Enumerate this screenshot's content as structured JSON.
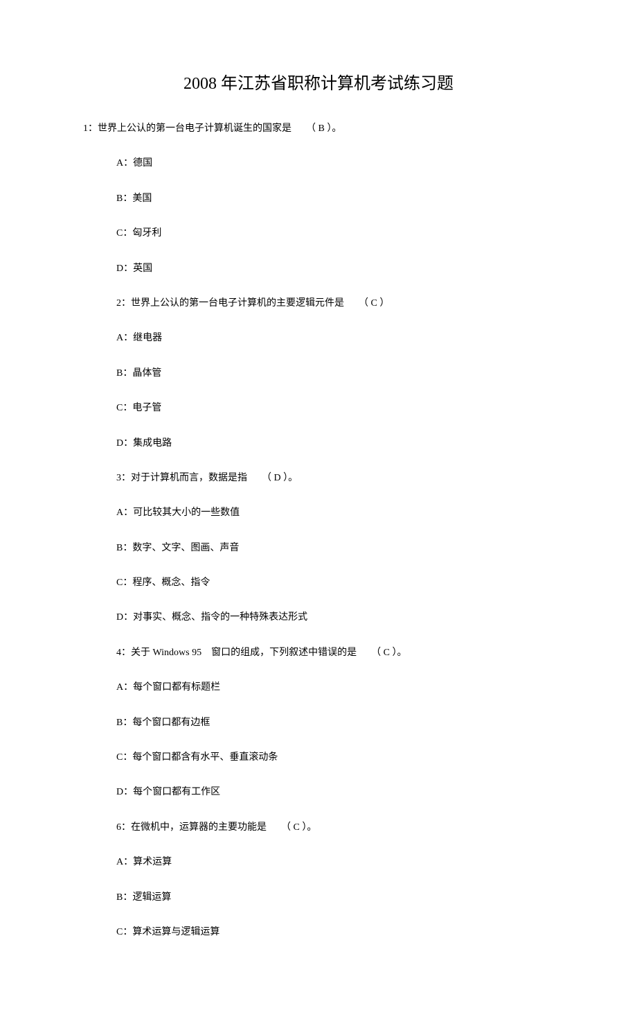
{
  "title": "2008 年江苏省职称计算机考试练习题",
  "q1": {
    "line": "1：世界上公认的第一台电子计算机诞生的国家是　　（ B ）。",
    "A": "A：德国",
    "B": "B：美国",
    "C": "C：匈牙利",
    "D": "D：英国"
  },
  "q2": {
    "line": "2：世界上公认的第一台电子计算机的主要逻辑元件是　　（ C ）",
    "A": "A：继电器",
    "B": "B：晶体管",
    "C": "C：电子管",
    "D": "D：集成电路"
  },
  "q3": {
    "line": "3：对于计算机而言，数据是指　　（ D ）。",
    "A": "A：可比较其大小的一些数值",
    "B": "B：数字、文字、图画、声音",
    "C": "C：程序、概念、指令",
    "D": "D：对事实、概念、指令的一种特殊表达形式"
  },
  "q4": {
    "line": "4：关于  Windows 95　窗口的组成，下列叙述中错误的是　　（ C ）。",
    "A": "A：每个窗口都有标题栏",
    "B": "B：每个窗口都有边框",
    "C": "C：每个窗口都含有水平、垂直滚动条",
    "D": "D：每个窗口都有工作区"
  },
  "q6": {
    "line": "6：在微机中，运算器的主要功能是　　（ C ）。",
    "A": "A：算术运算",
    "B": "B：逻辑运算",
    "C": "C：算术运算与逻辑运算"
  }
}
